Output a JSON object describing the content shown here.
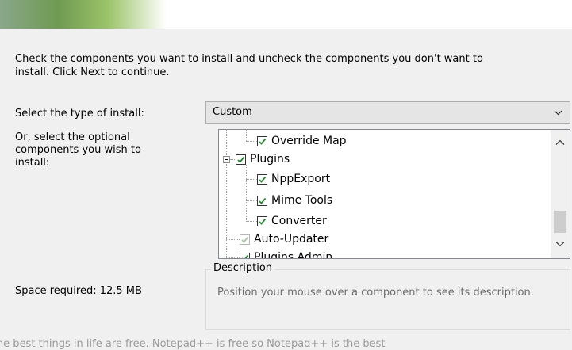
{
  "intro": {
    "line1": "Check the components you want to install and uncheck the components you don't want to",
    "line2": "install. Click Next to continue."
  },
  "install_type": {
    "label": "Select the type of install:",
    "selected": "Custom"
  },
  "optional": {
    "line1": "Or, select the optional",
    "line2": "components you wish to",
    "line3": "install:"
  },
  "components": [
    {
      "label": "Override Map",
      "checked": true
    },
    {
      "label": "Plugins",
      "checked": true
    },
    {
      "label": "NppExport",
      "checked": true
    },
    {
      "label": "Mime Tools",
      "checked": true
    },
    {
      "label": "Converter",
      "checked": true
    },
    {
      "label": "Auto-Updater",
      "checked": true,
      "disabled": true
    },
    {
      "label": "Plugins Admin",
      "checked": true
    }
  ],
  "description": {
    "title": "Description",
    "text": "Position your mouse over a component to see its description."
  },
  "space": {
    "text": "Space required: 12.5 MB"
  },
  "branding": {
    "text": "The best things in life are free. Notepad++ is free so Notepad++ is the best"
  },
  "colors": {
    "check": "#1f8a2e",
    "accent_green": "#6f9a52"
  }
}
